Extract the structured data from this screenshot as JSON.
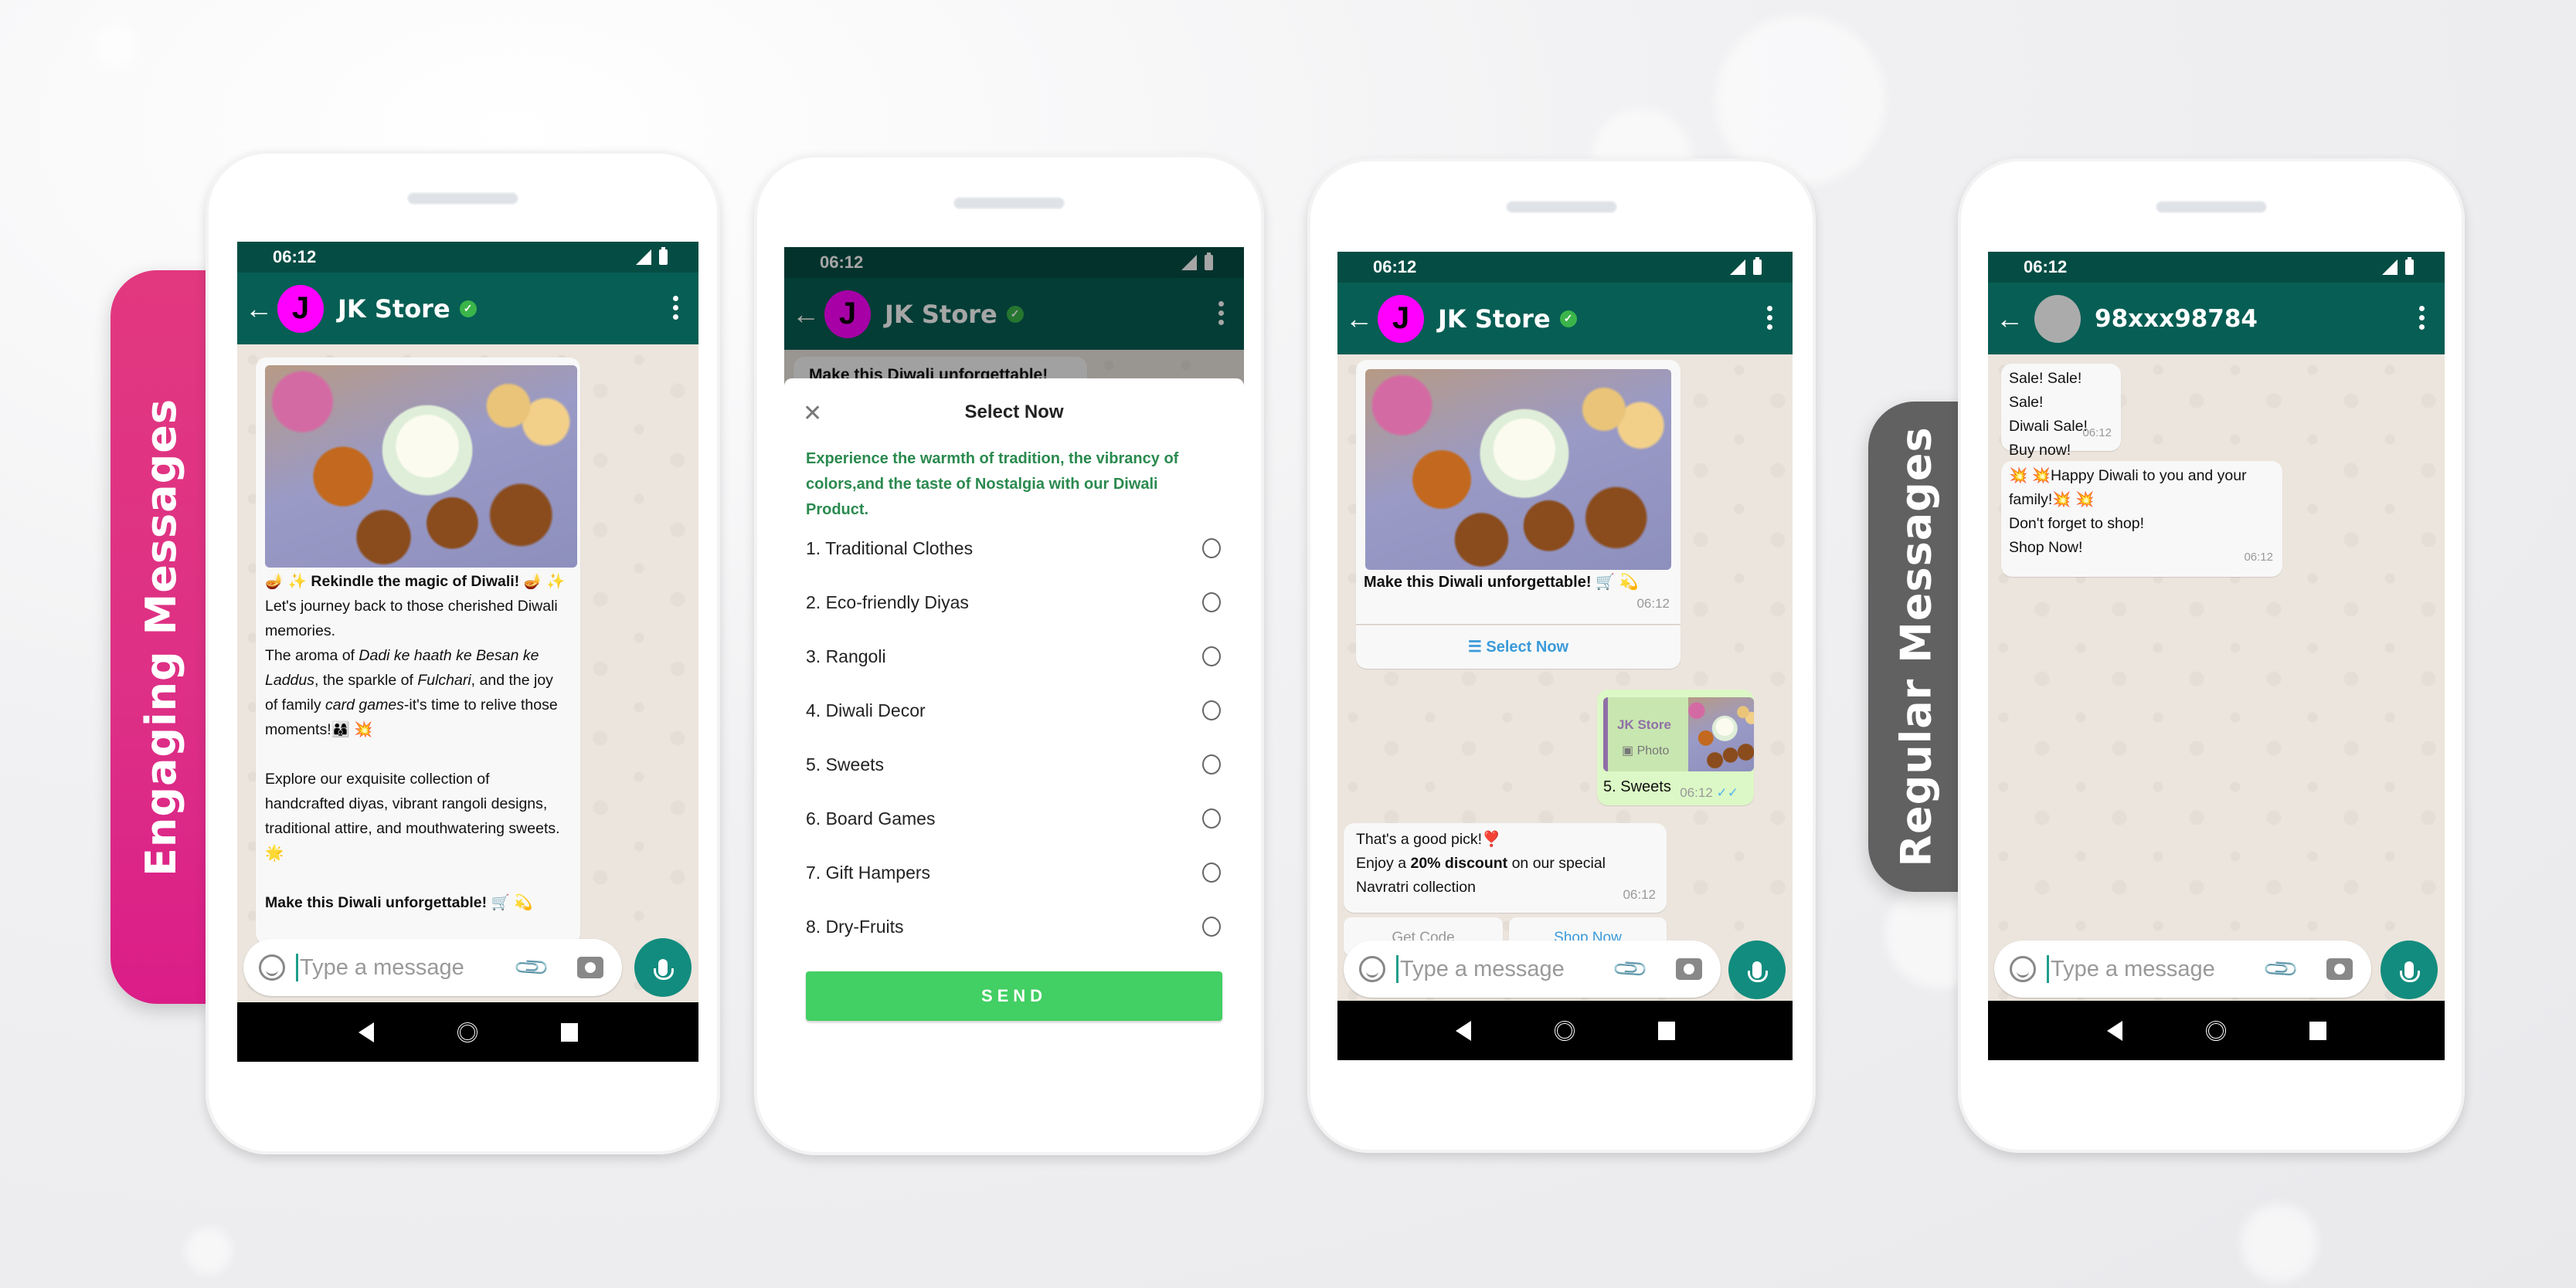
{
  "side_labels": {
    "engaging": "Engaging Messages",
    "regular": "Regular Messages"
  },
  "colors": {
    "engaging_label": "#dd2f86",
    "regular_label": "#616161",
    "whatsapp_header": "#075e54",
    "status_bar": "#054d44",
    "send_button": "#42cf63",
    "list_description": "#2b8a4f",
    "link_blue": "#3a9ad9",
    "avatar_magenta": "#ff00ff"
  },
  "status_bar": {
    "time": "06:12"
  },
  "input": {
    "placeholder": "Type a message"
  },
  "phones": [
    {
      "contact": {
        "name": "JK Store",
        "avatar_letter": "J",
        "verified": true
      },
      "message": {
        "headline": "🪔 ✨ Rekindle the magic of Diwali! 🪔 ✨",
        "p1": "Let's journey back to those cherished Diwali memories.",
        "p2_a": "The aroma of ",
        "p2_b": "Dadi ke haath ke Besan ke Laddus",
        "p2_c": ", the sparkle of  ",
        "p2_d": "Fulchari",
        "p2_e": ", and the joy of family ",
        "p2_f": "card games",
        "p2_g": "-it's time to relive those moments!👨‍👩‍👦 💥",
        "p3": " Explore our exquisite collection of handcrafted diyas, vibrant rangoli designs, traditional attire, and mouthwatering sweets. 🌟",
        "closing": "Make this Diwali unforgettable! 🛒 💫"
      }
    },
    {
      "contact": {
        "name": "JK Store",
        "avatar_letter": "J",
        "verified": true
      },
      "behind_text": "Make this Diwali unforgettable! 🛒 💫",
      "sheet": {
        "title": "Select Now",
        "description": "Experience the warmth of tradition, the vibrancy of colors,and the taste of Nostalgia with our Diwali Product.",
        "options": [
          "1. Traditional Clothes",
          "2. Eco-friendly Diyas",
          "3. Rangoli",
          "4. Diwali Decor",
          "5. Sweets",
          "6. Board Games",
          "7. Gift Hampers",
          "8. Dry-Fruits"
        ],
        "send_label": "SEND"
      }
    },
    {
      "contact": {
        "name": "JK Store",
        "avatar_letter": "J",
        "verified": true
      },
      "messages": {
        "image_caption": "Make this Diwali unforgettable! 🛒 💫",
        "image_time": "06:12",
        "select_button": "Select Now",
        "reply_quote_sender": "JK Store",
        "reply_quote_type": "Photo",
        "reply_text": "5. Sweets",
        "reply_time": "06:12",
        "response_line1": "That's a good pick!❣️",
        "response_line2_a": "Enjoy a ",
        "response_line2_b": "20% discount",
        "response_line2_c": " on our special",
        "response_line3": "Navratri collection",
        "response_time": "06:12",
        "button_get_code": "Get Code",
        "button_shop_now": "Shop Now"
      }
    },
    {
      "contact": {
        "name": "98xxx98784"
      },
      "messages": [
        {
          "lines": [
            "Sale! Sale! Sale!",
            "Diwali Sale!",
            "Buy now!"
          ],
          "time": "06:12"
        },
        {
          "lines": [
            "💥 💥Happy Diwali to you and your family!💥 💥",
            "Don't forget to shop!",
            "Shop Now!"
          ],
          "time": "06:12"
        }
      ]
    }
  ]
}
